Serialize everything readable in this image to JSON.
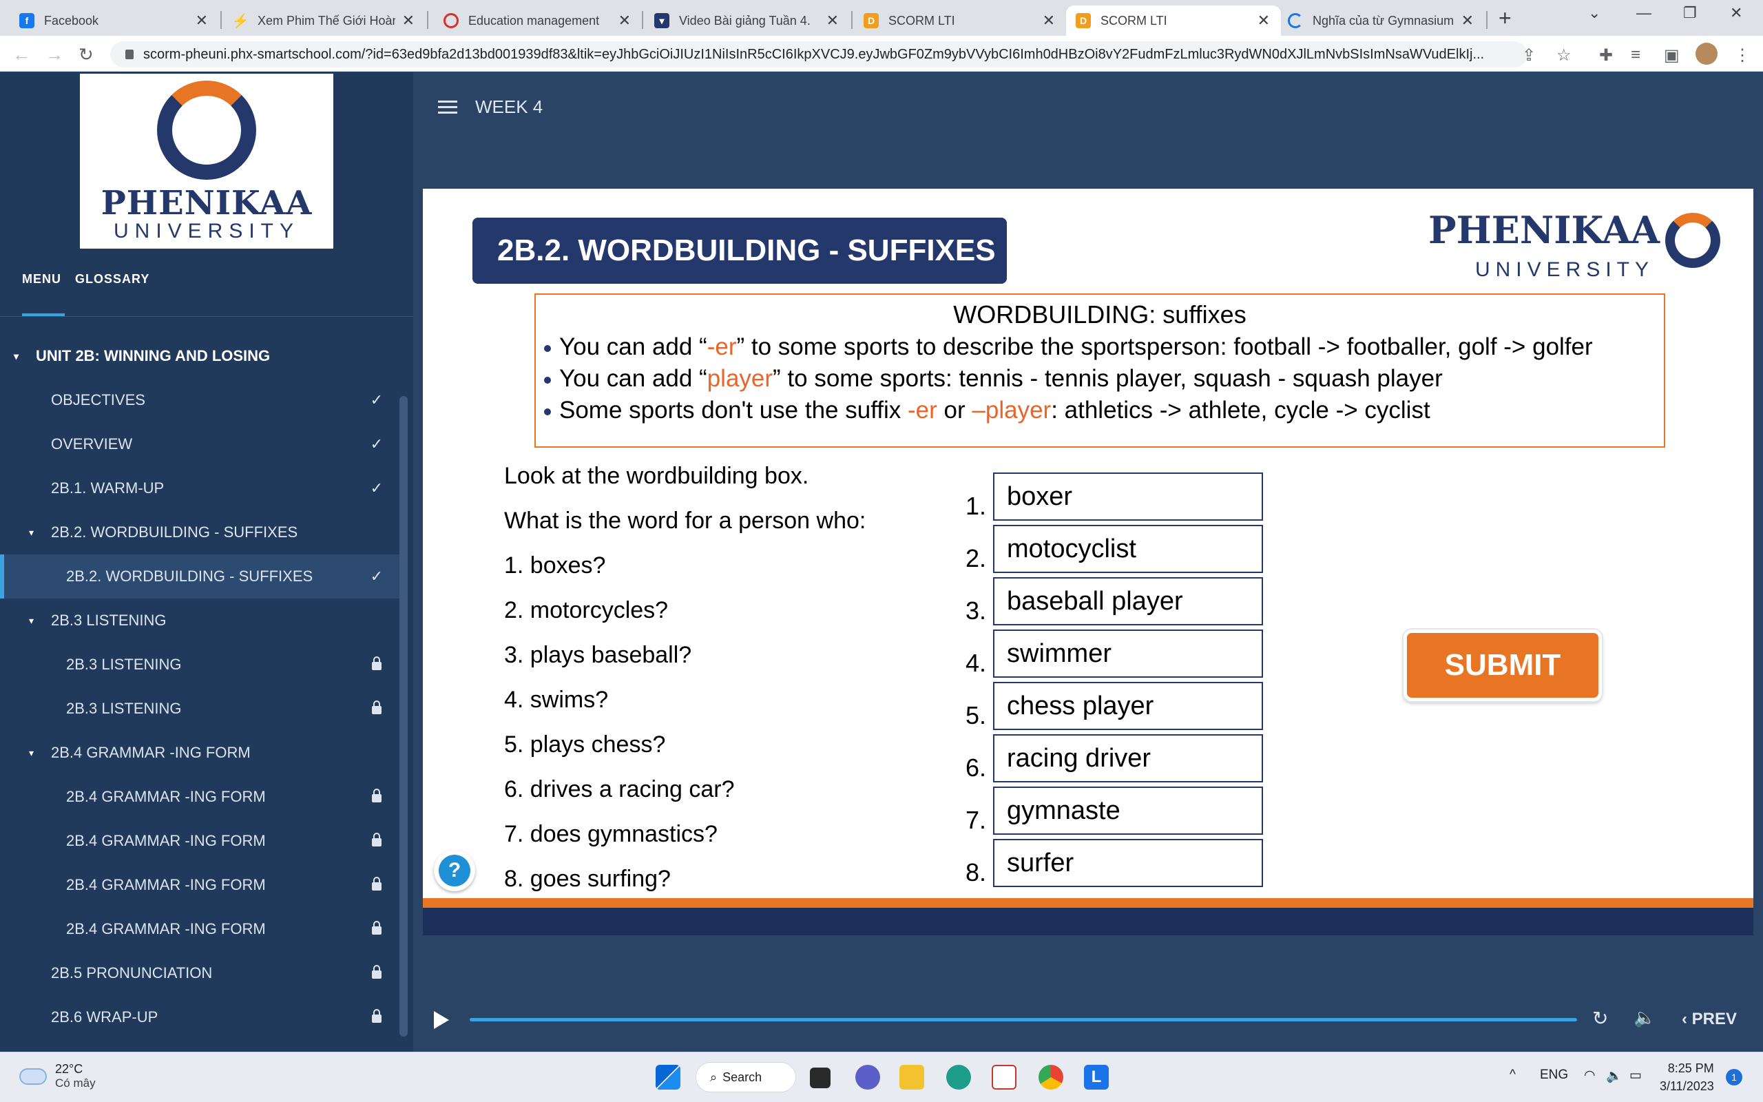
{
  "browser": {
    "tabs": [
      {
        "title": "Facebook",
        "favicon": "facebook-icon",
        "color": "#1877f2",
        "glyph": "f"
      },
      {
        "title": "Xem Phim Thế Giới Hoàn Mỹ",
        "favicon": "lightning-icon",
        "color": "#f5a623",
        "glyph": "⚡"
      },
      {
        "title": "Education management",
        "favicon": "education-icon",
        "color": "#d93025",
        "glyph": "◔"
      },
      {
        "title": "Video Bài giảng Tuần 4.",
        "favicon": "university-icon",
        "color": "#24386b",
        "glyph": "▾"
      },
      {
        "title": "SCORM LTI",
        "favicon": "scorm-icon",
        "color": "#f29d1c",
        "glyph": "D"
      },
      {
        "title": "SCORM LTI",
        "favicon": "scorm-icon",
        "color": "#f29d1c",
        "glyph": "D"
      },
      {
        "title": "Nghĩa của từ Gymnasium",
        "favicon": "loading-icon",
        "color": "#1a73e8",
        "glyph": "◌"
      }
    ],
    "url": "scorm-pheuni.phx-smartschool.com/?id=63ed9bfa2d13bd001939df83&ltik=eyJhbGciOiJIUzI1NiIsInR5cCI6IkpXVCJ9.eyJwbGF0Zm9ybVVybCI6Imh0dHBzOi8vY2FudmFzLmluc3RydWN0dXJlLmNvbSIsImNsaWVudElkIj..."
  },
  "sidebar": {
    "logo_word": "PHENIKAA",
    "logo_sub": "UNIVERSITY",
    "tabs": [
      "MENU",
      "GLOSSARY"
    ],
    "items": [
      {
        "label": "UNIT 2B: WINNING AND LOSING",
        "level": "unit",
        "state": "caret"
      },
      {
        "label": "OBJECTIVES",
        "level": "l1",
        "state": "check"
      },
      {
        "label": "OVERVIEW",
        "level": "l1",
        "state": "check"
      },
      {
        "label": "2B.1. WARM-UP",
        "level": "l1",
        "state": "check"
      },
      {
        "label": "2B.2. WORDBUILDING - SUFFIXES",
        "level": "l1c",
        "state": "caret"
      },
      {
        "label": "2B.2. WORDBUILDING - SUFFIXES",
        "level": "l2",
        "state": "check",
        "active": true
      },
      {
        "label": "2B.3 LISTENING",
        "level": "l1c",
        "state": "caret"
      },
      {
        "label": "2B.3 LISTENING",
        "level": "l2",
        "state": "lock"
      },
      {
        "label": "2B.3 LISTENING",
        "level": "l2",
        "state": "lock"
      },
      {
        "label": "2B.4 GRAMMAR -ING FORM",
        "level": "l1c",
        "state": "caret"
      },
      {
        "label": "2B.4 GRAMMAR -ING FORM",
        "level": "l2",
        "state": "lock"
      },
      {
        "label": "2B.4 GRAMMAR -ING FORM",
        "level": "l2",
        "state": "lock"
      },
      {
        "label": "2B.4 GRAMMAR -ING FORM",
        "level": "l2",
        "state": "lock"
      },
      {
        "label": "2B.4 GRAMMAR -ING FORM",
        "level": "l2",
        "state": "lock"
      },
      {
        "label": "2B.5 PRONUNCIATION",
        "level": "l1",
        "state": "lock"
      },
      {
        "label": "2B.6 WRAP-UP",
        "level": "l1",
        "state": "lock"
      }
    ]
  },
  "main": {
    "week": "WEEK 4",
    "slide_title": "2B.2. WORDBUILDING - SUFFIXES",
    "logo_word": "PHENIKAA",
    "logo_sub": "UNIVERSITY",
    "wordbuilding": {
      "title": "WORDBUILDING: suffixes",
      "line1": {
        "a": "You can add “",
        "hl": "-er",
        "b": "” to some sports to describe the sportsperson:  football -> footballer, golf -> golfer"
      },
      "line2": {
        "a": "You can add “",
        "hl": "player",
        "b": "” to some sports: tennis - tennis player, squash - squash player"
      },
      "line3": {
        "a": "Some sports don't use the suffix ",
        "hl": "-er",
        "mid": " or ",
        "hl2": "–player",
        "b": ": athletics -> athlete, cycle -> cyclist"
      }
    },
    "instruction1": "Look at the wordbuilding box.",
    "instruction2": "What is the word for a person who:",
    "questions": [
      "1. boxes?",
      "2. motorcycles?",
      "3. plays baseball?",
      "4. swims?",
      "5. plays chess?",
      "6. drives a racing car?",
      "7. does gymnastics?",
      "8. goes surfing?"
    ],
    "numbers": [
      "1.",
      "2.",
      "3.",
      "4.",
      "5.",
      "6.",
      "7.",
      "8."
    ],
    "answers": [
      "boxer",
      "motocyclist",
      "baseball player",
      "swimmer",
      "chess player",
      "racing driver",
      "gymnaste",
      "surfer"
    ],
    "submit_label": "SUBMIT",
    "help_label": "?"
  },
  "player": {
    "prev_label": "PREV"
  },
  "taskbar": {
    "temp": "22°C",
    "weather": "Có mây",
    "search_label": "Search",
    "lang": "ENG",
    "time": "8:25 PM",
    "date": "3/11/2023",
    "notifications": "1"
  },
  "colors": {
    "accent_orange": "#e87524",
    "navy": "#24386b",
    "sidebar_bg": "#213a5b",
    "highlight": "#e8662b"
  }
}
